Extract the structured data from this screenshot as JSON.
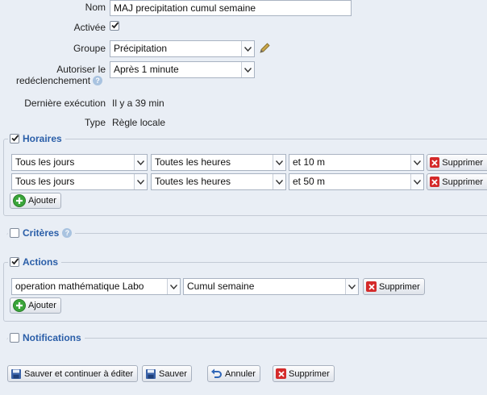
{
  "form": {
    "name_label": "Nom",
    "name_value": "MAJ precipitation cumul semaine",
    "enabled_label": "Activée",
    "group_label": "Groupe",
    "group_value": "Précipitation",
    "retrigger_label_1": "Autoriser le",
    "retrigger_label_2": "redéclenchement",
    "retrigger_value": "Après 1 minute",
    "last_run_label": "Dernière exécution",
    "last_run_value": "Il y a 39 min",
    "type_label": "Type",
    "type_value": "Règle locale",
    "help_glyph": "?"
  },
  "schedules": {
    "legend": "Horaires",
    "rows": [
      {
        "days": "Tous les jours",
        "hours": "Toutes les heures",
        "minutes": "et 10 m",
        "delete": "Supprimer"
      },
      {
        "days": "Tous les jours",
        "hours": "Toutes les heures",
        "minutes": "et 50 m",
        "delete": "Supprimer"
      }
    ],
    "add": "Ajouter"
  },
  "criteria": {
    "legend": "Critères"
  },
  "actions": {
    "legend": "Actions",
    "rows": [
      {
        "device": "operation mathématique Labo",
        "action": "Cumul semaine",
        "delete": "Supprimer"
      }
    ],
    "add": "Ajouter"
  },
  "notifications": {
    "legend": "Notifications"
  },
  "footer": {
    "save_continue": "Sauver et continuer à éditer",
    "save": "Sauver",
    "cancel": "Annuler",
    "delete": "Supprimer"
  },
  "colors": {
    "legend": "#2a5ea8",
    "background": "#e9eef5",
    "delete_icon": "#d42a2a",
    "add_icon": "#3aa53a"
  }
}
